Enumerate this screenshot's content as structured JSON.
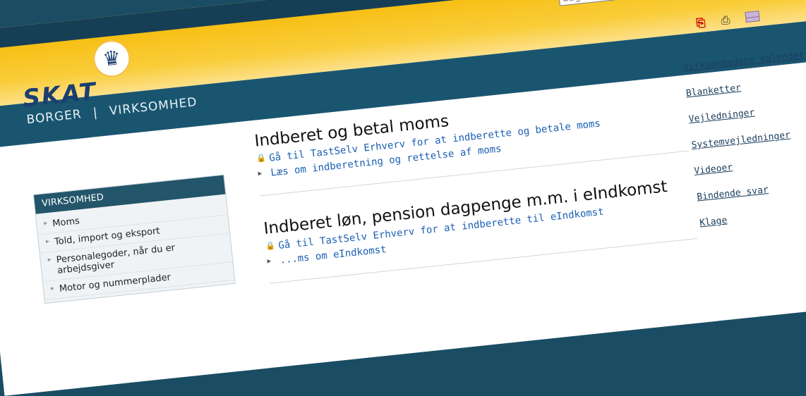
{
  "header": {
    "search_placeholder": "Søg...",
    "logo_text": "SKAT",
    "logo_icon": "crown-icon",
    "nav": {
      "borger": "BORGER",
      "separator": "|",
      "virksomhed": "VIRKSOMHED"
    }
  },
  "menu": {
    "title": "VIRKSOMHED",
    "items": [
      {
        "label": "Moms"
      },
      {
        "label": "Told, import og eksport"
      },
      {
        "label": "Personalegoder, når du er arbejdsgiver"
      },
      {
        "label": "Motor og nummerplader"
      }
    ]
  },
  "main": {
    "sections": [
      {
        "title": "Indberet og betal moms",
        "links": [
          {
            "icon": "lock-icon",
            "label": "Gå til TastSelv Erhverv for at indberette og betale moms"
          },
          {
            "icon": "arrow-icon",
            "label": "Læs om indberetning og rettelse af moms"
          }
        ]
      },
      {
        "title": "Indberet løn, pension dagpenge m.m. i eIndkomst",
        "links": [
          {
            "icon": "lock-icon",
            "label": "Gå til TastSelv Erhverv for at indberette til eIndkomst"
          },
          {
            "icon": "arrow-icon",
            "label": "...ms om eIndkomst"
          }
        ]
      }
    ]
  },
  "tools": {
    "pdf": "pdf-icon",
    "print": "print-icon",
    "mail": "mail-icon"
  },
  "right_links": [
    {
      "label": "Virksomhedens kalender"
    },
    {
      "label": "Blanketter"
    },
    {
      "label": "Vejledninger"
    },
    {
      "label": "Systemvejledninger"
    },
    {
      "label": "Videoer"
    },
    {
      "label": "Bindende svar"
    },
    {
      "label": "Klage"
    }
  ],
  "colors": {
    "header_yellow": "#f6b800",
    "nav_blue": "#1a5570",
    "link_blue": "#1a5fb4",
    "brand_blue": "#1b3e6f"
  }
}
